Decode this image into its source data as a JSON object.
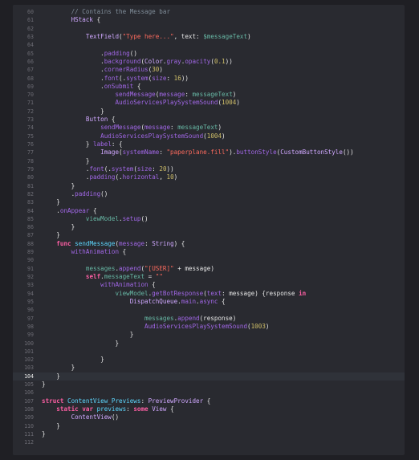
{
  "editor": {
    "current_line": 104,
    "lines": [
      {
        "n": "60",
        "indent": "        ",
        "tokens": [
          {
            "t": "cmt",
            "v": "// Contains the Message bar"
          }
        ]
      },
      {
        "n": "61",
        "indent": "        ",
        "tokens": [
          {
            "t": "typ",
            "v": "HStack"
          },
          {
            "t": "pl",
            "v": " {"
          }
        ]
      },
      {
        "n": "62",
        "indent": "",
        "tokens": []
      },
      {
        "n": "63",
        "indent": "            ",
        "tokens": [
          {
            "t": "typ",
            "v": "TextField"
          },
          {
            "t": "pl",
            "v": "("
          },
          {
            "t": "str",
            "v": "\"Type here...\""
          },
          {
            "t": "pl",
            "v": ", text: "
          },
          {
            "t": "prop",
            "v": "$messageText"
          },
          {
            "t": "pl",
            "v": ")"
          }
        ]
      },
      {
        "n": "64",
        "indent": "",
        "tokens": []
      },
      {
        "n": "65",
        "indent": "                ",
        "tokens": [
          {
            "t": "pl",
            "v": "."
          },
          {
            "t": "fn",
            "v": "padding"
          },
          {
            "t": "pl",
            "v": "()"
          }
        ]
      },
      {
        "n": "66",
        "indent": "                ",
        "tokens": [
          {
            "t": "pl",
            "v": "."
          },
          {
            "t": "fn",
            "v": "background"
          },
          {
            "t": "pl",
            "v": "("
          },
          {
            "t": "typ",
            "v": "Color"
          },
          {
            "t": "pl",
            "v": "."
          },
          {
            "t": "fn",
            "v": "gray"
          },
          {
            "t": "pl",
            "v": "."
          },
          {
            "t": "fn",
            "v": "opacity"
          },
          {
            "t": "pl",
            "v": "("
          },
          {
            "t": "num",
            "v": "0.1"
          },
          {
            "t": "pl",
            "v": "))"
          }
        ]
      },
      {
        "n": "67",
        "indent": "                ",
        "tokens": [
          {
            "t": "pl",
            "v": "."
          },
          {
            "t": "fn",
            "v": "cornerRadius"
          },
          {
            "t": "pl",
            "v": "("
          },
          {
            "t": "num",
            "v": "30"
          },
          {
            "t": "pl",
            "v": ")"
          }
        ]
      },
      {
        "n": "68",
        "indent": "                ",
        "tokens": [
          {
            "t": "pl",
            "v": "."
          },
          {
            "t": "fn",
            "v": "font"
          },
          {
            "t": "pl",
            "v": "(."
          },
          {
            "t": "fn",
            "v": "system"
          },
          {
            "t": "pl",
            "v": "("
          },
          {
            "t": "fn",
            "v": "size"
          },
          {
            "t": "pl",
            "v": ": "
          },
          {
            "t": "num",
            "v": "16"
          },
          {
            "t": "pl",
            "v": "))"
          }
        ]
      },
      {
        "n": "69",
        "indent": "                ",
        "tokens": [
          {
            "t": "pl",
            "v": "."
          },
          {
            "t": "fn",
            "v": "onSubmit"
          },
          {
            "t": "pl",
            "v": " {"
          }
        ]
      },
      {
        "n": "70",
        "indent": "                    ",
        "tokens": [
          {
            "t": "fn",
            "v": "sendMessage"
          },
          {
            "t": "pl",
            "v": "("
          },
          {
            "t": "fn",
            "v": "message"
          },
          {
            "t": "pl",
            "v": ": "
          },
          {
            "t": "prop",
            "v": "messageText"
          },
          {
            "t": "pl",
            "v": ")"
          }
        ]
      },
      {
        "n": "71",
        "indent": "                    ",
        "tokens": [
          {
            "t": "fn",
            "v": "AudioServicesPlaySystemSound"
          },
          {
            "t": "pl",
            "v": "("
          },
          {
            "t": "num",
            "v": "1004"
          },
          {
            "t": "pl",
            "v": ")"
          }
        ]
      },
      {
        "n": "72",
        "indent": "                ",
        "tokens": [
          {
            "t": "pl",
            "v": "}"
          }
        ]
      },
      {
        "n": "73",
        "indent": "            ",
        "tokens": [
          {
            "t": "typ",
            "v": "Button"
          },
          {
            "t": "pl",
            "v": " {"
          }
        ]
      },
      {
        "n": "74",
        "indent": "                ",
        "tokens": [
          {
            "t": "fn",
            "v": "sendMessage"
          },
          {
            "t": "pl",
            "v": "("
          },
          {
            "t": "fn",
            "v": "message"
          },
          {
            "t": "pl",
            "v": ": "
          },
          {
            "t": "prop",
            "v": "messageText"
          },
          {
            "t": "pl",
            "v": ")"
          }
        ]
      },
      {
        "n": "75",
        "indent": "                ",
        "tokens": [
          {
            "t": "fn",
            "v": "AudioServicesPlaySystemSound"
          },
          {
            "t": "pl",
            "v": "("
          },
          {
            "t": "num",
            "v": "1004"
          },
          {
            "t": "pl",
            "v": ")"
          }
        ]
      },
      {
        "n": "76",
        "indent": "            ",
        "tokens": [
          {
            "t": "pl",
            "v": "} "
          },
          {
            "t": "fn",
            "v": "label"
          },
          {
            "t": "pl",
            "v": ": {"
          }
        ]
      },
      {
        "n": "77",
        "indent": "                ",
        "tokens": [
          {
            "t": "typ",
            "v": "Image"
          },
          {
            "t": "pl",
            "v": "("
          },
          {
            "t": "fn",
            "v": "systemName"
          },
          {
            "t": "pl",
            "v": ": "
          },
          {
            "t": "str",
            "v": "\"paperplane.fill\""
          },
          {
            "t": "pl",
            "v": ")."
          },
          {
            "t": "fn",
            "v": "buttonStyle"
          },
          {
            "t": "pl",
            "v": "("
          },
          {
            "t": "typ",
            "v": "CustomButtonStyle"
          },
          {
            "t": "pl",
            "v": "())"
          }
        ]
      },
      {
        "n": "78",
        "indent": "            ",
        "tokens": [
          {
            "t": "pl",
            "v": "}"
          }
        ]
      },
      {
        "n": "79",
        "indent": "            ",
        "tokens": [
          {
            "t": "pl",
            "v": "."
          },
          {
            "t": "fn",
            "v": "font"
          },
          {
            "t": "pl",
            "v": "(."
          },
          {
            "t": "fn",
            "v": "system"
          },
          {
            "t": "pl",
            "v": "("
          },
          {
            "t": "fn",
            "v": "size"
          },
          {
            "t": "pl",
            "v": ": "
          },
          {
            "t": "num",
            "v": "20"
          },
          {
            "t": "pl",
            "v": "))"
          }
        ]
      },
      {
        "n": "80",
        "indent": "            ",
        "tokens": [
          {
            "t": "pl",
            "v": "."
          },
          {
            "t": "fn",
            "v": "padding"
          },
          {
            "t": "pl",
            "v": "(."
          },
          {
            "t": "fn",
            "v": "horizontal"
          },
          {
            "t": "pl",
            "v": ", "
          },
          {
            "t": "num",
            "v": "10"
          },
          {
            "t": "pl",
            "v": ")"
          }
        ]
      },
      {
        "n": "81",
        "indent": "        ",
        "tokens": [
          {
            "t": "pl",
            "v": "}"
          }
        ]
      },
      {
        "n": "82",
        "indent": "        ",
        "tokens": [
          {
            "t": "pl",
            "v": "."
          },
          {
            "t": "fn",
            "v": "padding"
          },
          {
            "t": "pl",
            "v": "()"
          }
        ]
      },
      {
        "n": "83",
        "indent": "    ",
        "tokens": [
          {
            "t": "pl",
            "v": "}"
          }
        ]
      },
      {
        "n": "84",
        "indent": "    ",
        "tokens": [
          {
            "t": "pl",
            "v": "."
          },
          {
            "t": "fn",
            "v": "onAppear"
          },
          {
            "t": "pl",
            "v": " {"
          }
        ]
      },
      {
        "n": "85",
        "indent": "            ",
        "tokens": [
          {
            "t": "prop",
            "v": "viewModel"
          },
          {
            "t": "pl",
            "v": "."
          },
          {
            "t": "fn",
            "v": "setup"
          },
          {
            "t": "pl",
            "v": "()"
          }
        ]
      },
      {
        "n": "86",
        "indent": "        ",
        "tokens": [
          {
            "t": "pl",
            "v": "}"
          }
        ]
      },
      {
        "n": "87",
        "indent": "    ",
        "tokens": [
          {
            "t": "pl",
            "v": "}"
          }
        ]
      },
      {
        "n": "88",
        "indent": "    ",
        "tokens": [
          {
            "t": "kw",
            "v": "func"
          },
          {
            "t": "pl",
            "v": " "
          },
          {
            "t": "blu",
            "v": "sendMessage"
          },
          {
            "t": "pl",
            "v": "("
          },
          {
            "t": "fn",
            "v": "message"
          },
          {
            "t": "pl",
            "v": ": "
          },
          {
            "t": "typ",
            "v": "String"
          },
          {
            "t": "pl",
            "v": ") {"
          }
        ]
      },
      {
        "n": "89",
        "indent": "        ",
        "tokens": [
          {
            "t": "fn",
            "v": "withAnimation"
          },
          {
            "t": "pl",
            "v": " {"
          }
        ]
      },
      {
        "n": "90",
        "indent": "",
        "tokens": []
      },
      {
        "n": "91",
        "indent": "            ",
        "tokens": [
          {
            "t": "prop",
            "v": "messages"
          },
          {
            "t": "pl",
            "v": "."
          },
          {
            "t": "fn",
            "v": "append"
          },
          {
            "t": "pl",
            "v": "("
          },
          {
            "t": "str",
            "v": "\"[USER]\""
          },
          {
            "t": "pl",
            "v": " + message)"
          }
        ]
      },
      {
        "n": "92",
        "indent": "            ",
        "tokens": [
          {
            "t": "kw",
            "v": "self"
          },
          {
            "t": "pl",
            "v": "."
          },
          {
            "t": "prop",
            "v": "messageText"
          },
          {
            "t": "pl",
            "v": " = "
          },
          {
            "t": "str",
            "v": "\"\""
          }
        ]
      },
      {
        "n": "93",
        "indent": "                ",
        "tokens": [
          {
            "t": "fn",
            "v": "withAnimation"
          },
          {
            "t": "pl",
            "v": " {"
          }
        ]
      },
      {
        "n": "94",
        "indent": "                    ",
        "tokens": [
          {
            "t": "prop",
            "v": "viewModel"
          },
          {
            "t": "pl",
            "v": "."
          },
          {
            "t": "fn",
            "v": "getBotResponse"
          },
          {
            "t": "pl",
            "v": "("
          },
          {
            "t": "fn",
            "v": "text"
          },
          {
            "t": "pl",
            "v": ": message) {response "
          },
          {
            "t": "kw",
            "v": "in"
          }
        ]
      },
      {
        "n": "95",
        "indent": "                        ",
        "tokens": [
          {
            "t": "typ",
            "v": "DispatchQueue"
          },
          {
            "t": "pl",
            "v": "."
          },
          {
            "t": "fn",
            "v": "main"
          },
          {
            "t": "pl",
            "v": "."
          },
          {
            "t": "fn",
            "v": "async"
          },
          {
            "t": "pl",
            "v": " {"
          }
        ]
      },
      {
        "n": "96",
        "indent": "",
        "tokens": []
      },
      {
        "n": "97",
        "indent": "                            ",
        "tokens": [
          {
            "t": "prop",
            "v": "messages"
          },
          {
            "t": "pl",
            "v": "."
          },
          {
            "t": "fn",
            "v": "append"
          },
          {
            "t": "pl",
            "v": "(response)"
          }
        ]
      },
      {
        "n": "98",
        "indent": "                            ",
        "tokens": [
          {
            "t": "fn",
            "v": "AudioServicesPlaySystemSound"
          },
          {
            "t": "pl",
            "v": "("
          },
          {
            "t": "num",
            "v": "1003"
          },
          {
            "t": "pl",
            "v": ")"
          }
        ]
      },
      {
        "n": "99",
        "indent": "                        ",
        "tokens": [
          {
            "t": "pl",
            "v": "}"
          }
        ]
      },
      {
        "n": "100",
        "indent": "                    ",
        "tokens": [
          {
            "t": "pl",
            "v": "}"
          }
        ]
      },
      {
        "n": "101",
        "indent": "",
        "tokens": []
      },
      {
        "n": "102",
        "indent": "                ",
        "tokens": [
          {
            "t": "pl",
            "v": "}"
          }
        ]
      },
      {
        "n": "103",
        "indent": "        ",
        "tokens": [
          {
            "t": "pl",
            "v": "}"
          }
        ]
      },
      {
        "n": "104",
        "indent": "    ",
        "tokens": [
          {
            "t": "pl",
            "v": "}"
          }
        ]
      },
      {
        "n": "105",
        "indent": "",
        "tokens": [
          {
            "t": "pl",
            "v": "}"
          }
        ]
      },
      {
        "n": "106",
        "indent": "",
        "tokens": []
      },
      {
        "n": "107",
        "indent": "",
        "tokens": [
          {
            "t": "kw",
            "v": "struct"
          },
          {
            "t": "pl",
            "v": " "
          },
          {
            "t": "blu",
            "v": "ContentView_Previews"
          },
          {
            "t": "pl",
            "v": ": "
          },
          {
            "t": "typ",
            "v": "PreviewProvider"
          },
          {
            "t": "pl",
            "v": " {"
          }
        ]
      },
      {
        "n": "108",
        "indent": "    ",
        "tokens": [
          {
            "t": "kw",
            "v": "static"
          },
          {
            "t": "pl",
            "v": " "
          },
          {
            "t": "kw",
            "v": "var"
          },
          {
            "t": "pl",
            "v": " "
          },
          {
            "t": "blu",
            "v": "previews"
          },
          {
            "t": "pl",
            "v": ": "
          },
          {
            "t": "kw",
            "v": "some"
          },
          {
            "t": "pl",
            "v": " "
          },
          {
            "t": "typ",
            "v": "View"
          },
          {
            "t": "pl",
            "v": " {"
          }
        ]
      },
      {
        "n": "109",
        "indent": "        ",
        "tokens": [
          {
            "t": "typ",
            "v": "ContentView"
          },
          {
            "t": "pl",
            "v": "()"
          }
        ]
      },
      {
        "n": "110",
        "indent": "    ",
        "tokens": [
          {
            "t": "pl",
            "v": "}"
          }
        ]
      },
      {
        "n": "111",
        "indent": "",
        "tokens": [
          {
            "t": "pl",
            "v": "}"
          }
        ]
      },
      {
        "n": "112",
        "indent": "",
        "tokens": []
      }
    ]
  }
}
